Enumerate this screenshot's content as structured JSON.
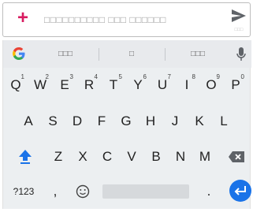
{
  "compose": {
    "plus_icon": "plus-icon",
    "placeholder": "□□□□□□□□□□ □□□ □□□□□□",
    "send_icon": "send-icon",
    "send_sublabel": "□□□",
    "accent": "#d81b60"
  },
  "keyboard": {
    "suggestions": [
      "□□□",
      "□",
      "□□□"
    ],
    "rows": {
      "row1": [
        {
          "label": "Q",
          "hint": "1"
        },
        {
          "label": "W",
          "hint": "2"
        },
        {
          "label": "E",
          "hint": "3"
        },
        {
          "label": "R",
          "hint": "4"
        },
        {
          "label": "T",
          "hint": "5"
        },
        {
          "label": "Y",
          "hint": "6"
        },
        {
          "label": "U",
          "hint": "7"
        },
        {
          "label": "I",
          "hint": "8"
        },
        {
          "label": "O",
          "hint": "9"
        },
        {
          "label": "P",
          "hint": "0"
        }
      ],
      "row2": [
        "A",
        "S",
        "D",
        "F",
        "G",
        "H",
        "J",
        "K",
        "L"
      ],
      "row3": [
        "Z",
        "X",
        "C",
        "V",
        "B",
        "N",
        "M"
      ]
    },
    "symbols_label": "?123",
    "comma": ",",
    "period": ".",
    "enter_color": "#1a73e8",
    "shift_color": "#1a73e8"
  }
}
